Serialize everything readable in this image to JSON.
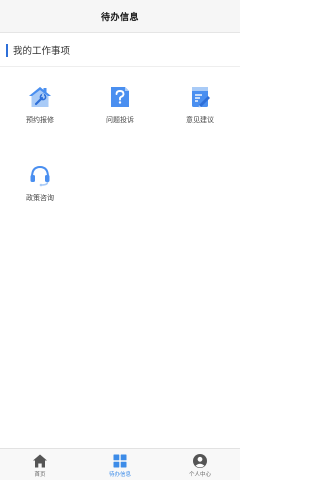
{
  "header": {
    "title": "待办信息"
  },
  "section": {
    "title": "我的工作事项"
  },
  "tiles": [
    {
      "label": "预约报修",
      "icon": "house-repair-icon"
    },
    {
      "label": "问题投诉",
      "icon": "question-complaint-icon"
    },
    {
      "label": "意见建议",
      "icon": "suggestion-notepad-icon"
    },
    {
      "label": "政策咨询",
      "icon": "headset-icon"
    }
  ],
  "tabbar": {
    "items": [
      {
        "label": "首页",
        "icon": "home-icon",
        "active": false
      },
      {
        "label": "待办信息",
        "icon": "grid-icon",
        "active": true
      },
      {
        "label": "个人中心",
        "icon": "user-icon",
        "active": false
      }
    ]
  },
  "colors": {
    "accent": "#2e6fd8",
    "icon_blue": "#4a8ff0",
    "icon_light": "#a9cbf7",
    "active_tab": "#3d8ce8",
    "inactive_tab": "#555555"
  }
}
